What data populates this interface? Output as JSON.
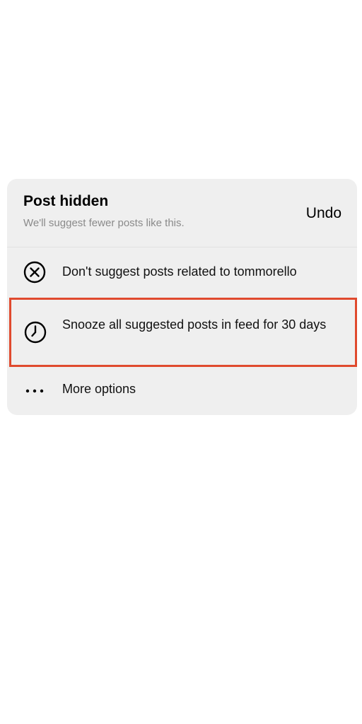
{
  "header": {
    "title": "Post hidden",
    "subtitle": "We'll suggest fewer posts like this.",
    "undo_label": "Undo"
  },
  "options": [
    {
      "icon": "close-circle-icon",
      "label": "Don't suggest posts related to tommorello"
    },
    {
      "icon": "clock-icon",
      "label": "Snooze all suggested posts in feed for 30 days",
      "highlighted": true
    },
    {
      "icon": "more-horizontal-icon",
      "label": "More options"
    }
  ],
  "colors": {
    "card_background": "#efefef",
    "highlight_border": "#e04a2e",
    "subtitle_text": "#8a8a8a"
  }
}
